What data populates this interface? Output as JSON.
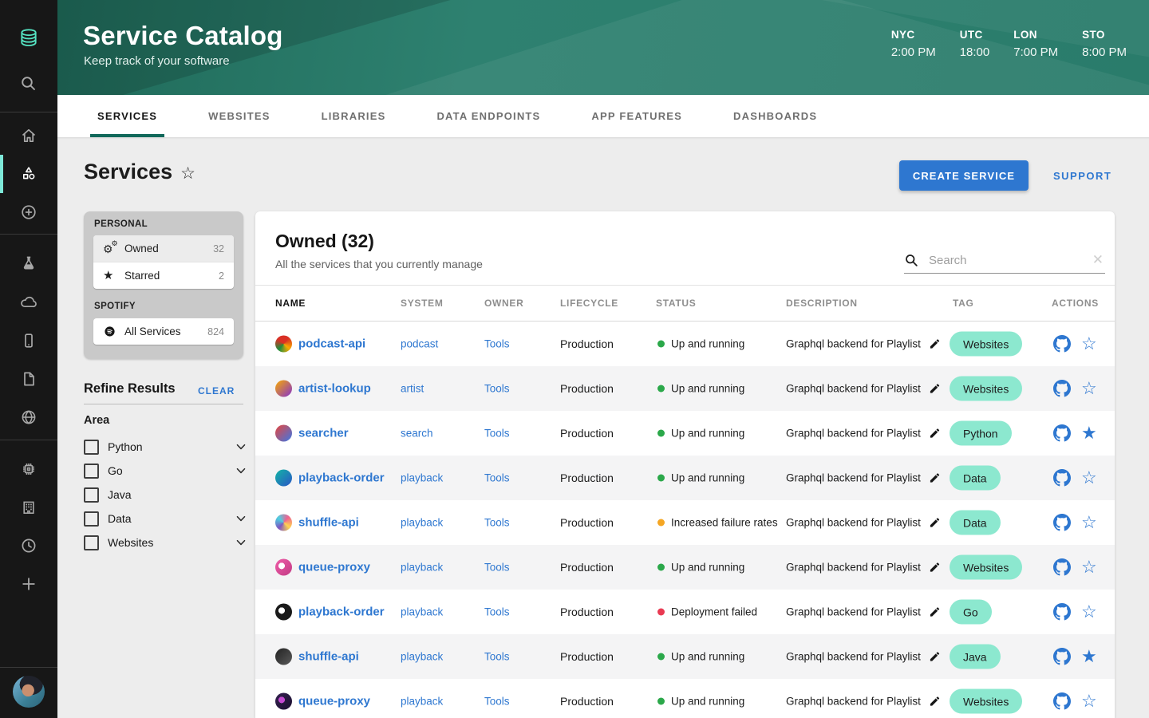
{
  "colors": {
    "accent_blue": "#2E77D0",
    "tag_teal": "#8CE8CF",
    "status_ok": "#2BA84A",
    "status_warn": "#F5A623",
    "status_error": "#E93A52",
    "tab_underline": "#11685A",
    "sidebar_active": "#7DE8D8"
  },
  "sidebar": {
    "items": [
      {
        "name": "backstage-logo"
      },
      {
        "name": "search-icon"
      },
      {
        "name": "home-icon"
      },
      {
        "name": "catalog-icon",
        "active": true
      },
      {
        "name": "create-icon"
      },
      {
        "name": "flask-icon"
      },
      {
        "name": "cloud-icon"
      },
      {
        "name": "mobile-icon"
      },
      {
        "name": "docs-icon"
      },
      {
        "name": "globe-icon"
      },
      {
        "name": "chip-icon"
      },
      {
        "name": "building-icon"
      },
      {
        "name": "clock-icon"
      },
      {
        "name": "plus-icon"
      }
    ],
    "avatar": "user-avatar"
  },
  "header": {
    "title": "Service Catalog",
    "subtitle": "Keep track of your software",
    "clocks": [
      {
        "label": "NYC",
        "time": "2:00 PM"
      },
      {
        "label": "UTC",
        "time": "18:00"
      },
      {
        "label": "LON",
        "time": "7:00 PM"
      },
      {
        "label": "STO",
        "time": "8:00 PM"
      }
    ]
  },
  "tabs": {
    "active": 0,
    "items": [
      "SERVICES",
      "WEBSITES",
      "LIBRARIES",
      "DATA ENDPOINTS",
      "APP FEATURES",
      "DASHBOARDS"
    ]
  },
  "page": {
    "title": "Services",
    "favorite_icon": "☆",
    "create_button": "CREATE SERVICE",
    "support_link": "SUPPORT"
  },
  "filters": {
    "personal": {
      "label": "PERSONAL",
      "items": [
        {
          "icon": "gears-icon",
          "label": "Owned",
          "count": "32",
          "selected": true
        },
        {
          "icon": "star-icon",
          "label": "Starred",
          "count": "2",
          "selected": false
        }
      ]
    },
    "org": {
      "label": "SPOTIFY",
      "items": [
        {
          "icon": "spotify-icon",
          "label": "All Services",
          "count": "824",
          "selected": false
        }
      ]
    },
    "refine": {
      "title": "Refine Results",
      "clear": "CLEAR",
      "group": "Area",
      "options": [
        {
          "label": "Python",
          "chevron": true,
          "checked": false
        },
        {
          "label": "Go",
          "chevron": true,
          "checked": false
        },
        {
          "label": "Java",
          "chevron": false,
          "checked": false
        },
        {
          "label": "Data",
          "chevron": true,
          "checked": false
        },
        {
          "label": "Websites",
          "chevron": true,
          "checked": false
        }
      ]
    }
  },
  "table": {
    "title": "Owned (32)",
    "subtitle": "All the services that you currently manage",
    "search_placeholder": "Search",
    "columns": [
      "NAME",
      "SYSTEM",
      "OWNER",
      "LIFECYCLE",
      "STATUS",
      "DESCRIPTION",
      "TAG",
      "ACTIONS"
    ],
    "rows": [
      {
        "name": "podcast-api",
        "system": "podcast",
        "owner": "Tools",
        "lifecycle": "Production",
        "status": "Up and running",
        "status_level": "ok",
        "description": "Graphql backend for Playlist",
        "tag": "Websites",
        "starred": false,
        "icon_colors": [
          "#d93025",
          "#f9ab00",
          "#1e8e3e",
          "#d93025"
        ]
      },
      {
        "name": "artist-lookup",
        "system": "artist",
        "owner": "Tools",
        "lifecycle": "Production",
        "status": "Up and running",
        "status_level": "ok",
        "description": "Graphql backend for Playlist",
        "tag": "Websites",
        "starred": false,
        "icon_colors": [
          "#f9ab00",
          "#8430ce"
        ]
      },
      {
        "name": "searcher",
        "system": "search",
        "owner": "Tools",
        "lifecycle": "Production",
        "status": "Up and running",
        "status_level": "ok",
        "description": "Graphql backend for Playlist",
        "tag": "Python",
        "starred": true,
        "icon_colors": [
          "#e8453c",
          "#3b78e7"
        ]
      },
      {
        "name": "playback-order",
        "system": "playback",
        "owner": "Tools",
        "lifecycle": "Production",
        "status": "Up and running",
        "status_level": "ok",
        "description": "Graphql backend for Playlist",
        "tag": "Data",
        "starred": false,
        "icon_colors": [
          "#12b5a5",
          "#2a56c6"
        ]
      },
      {
        "name": "shuffle-api",
        "system": "playback",
        "owner": "Tools",
        "lifecycle": "Production",
        "status": "Increased failure rates",
        "status_level": "warn",
        "description": "Graphql backend for Playlist",
        "tag": "Data",
        "starred": false,
        "icon_colors": [
          "#ef6292",
          "#ffd54f",
          "#7e57c2",
          "#4dd0e1"
        ]
      },
      {
        "name": "queue-proxy",
        "system": "playback",
        "owner": "Tools",
        "lifecycle": "Production",
        "status": "Up and running",
        "status_level": "ok",
        "description": "Graphql backend for Playlist",
        "tag": "Websites",
        "starred": false,
        "icon_colors": [
          "#ef5da8",
          "#c23a84"
        ],
        "icon_dot": "#ffffff"
      },
      {
        "name": "playback-order",
        "system": "playback",
        "owner": "Tools",
        "lifecycle": "Production",
        "status": "Deployment failed",
        "status_level": "error",
        "description": "Graphql backend for Playlist",
        "tag": "Go",
        "starred": false,
        "icon_colors": [
          "#1a1a1a",
          "#1a1a1a"
        ],
        "icon_dot": "#ffffff"
      },
      {
        "name": "shuffle-api",
        "system": "playback",
        "owner": "Tools",
        "lifecycle": "Production",
        "status": "Up and running",
        "status_level": "ok",
        "description": "Graphql backend for Playlist",
        "tag": "Java",
        "starred": true,
        "icon_colors": [
          "#222222",
          "#5a5a5a"
        ]
      },
      {
        "name": "queue-proxy",
        "system": "playback",
        "owner": "Tools",
        "lifecycle": "Production",
        "status": "Up and running",
        "status_level": "ok",
        "description": "Graphql backend for Playlist",
        "tag": "Websites",
        "starred": false,
        "icon_colors": [
          "#33204f",
          "#1c1030"
        ],
        "icon_dot": "#c44bd1"
      }
    ]
  }
}
